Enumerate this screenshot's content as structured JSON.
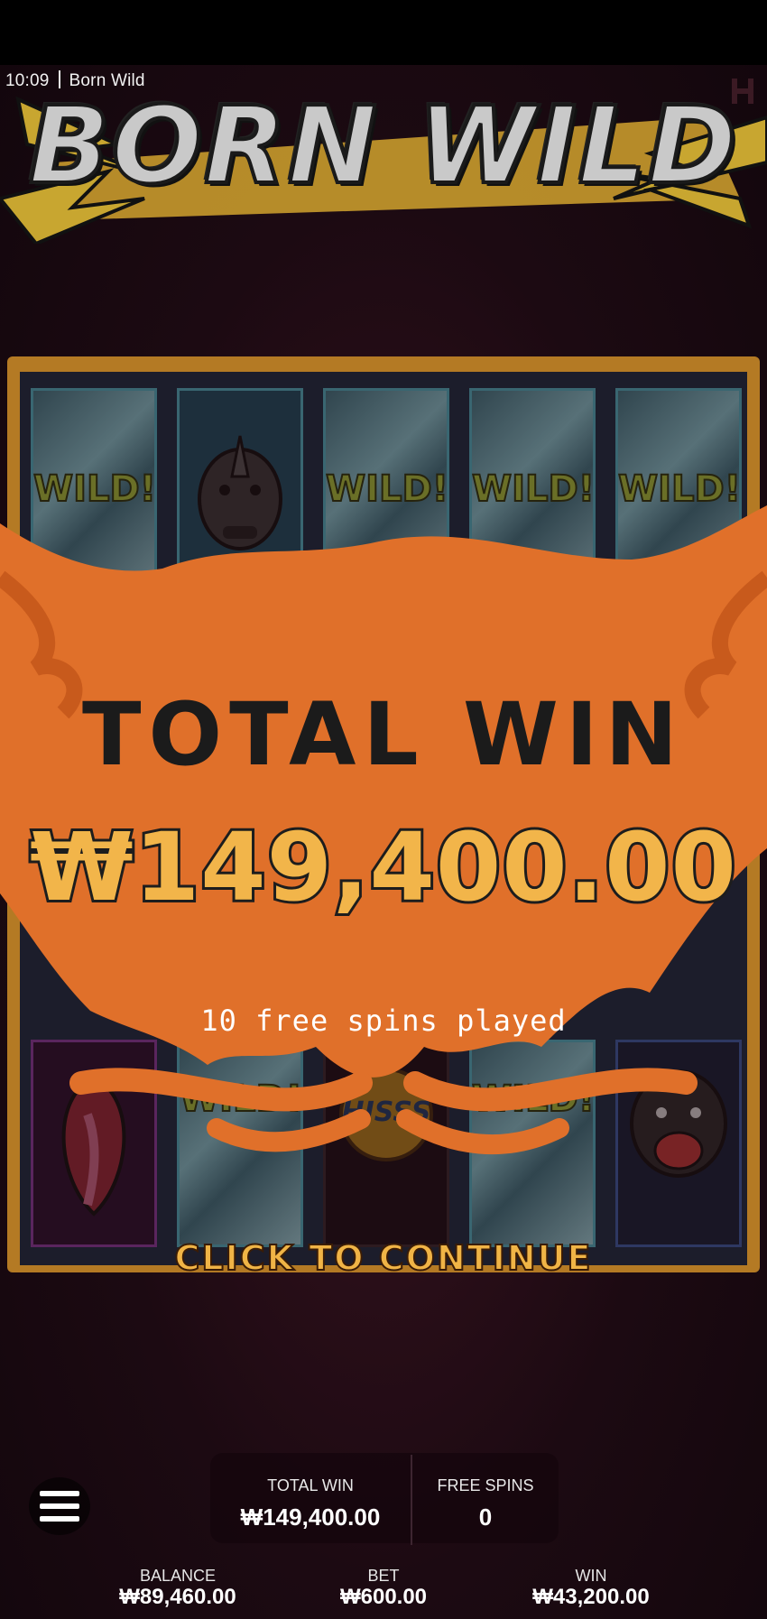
{
  "status_bar": {
    "time": "10:09",
    "app_name": "Born Wild"
  },
  "logo": {
    "text": "BORN WILD"
  },
  "reels": {
    "top_row": [
      "WILD!",
      "rhino",
      "WILD!",
      "WILD!",
      "WILD!"
    ],
    "bottom_row": [
      "cobra",
      "WILD!",
      "HISSS",
      "WILD!",
      "gorilla"
    ]
  },
  "popup": {
    "title": "TOTAL WIN",
    "amount": "₩149,400.00",
    "subtitle": "10 free spins played",
    "continue_label": "CLICK TO CONTINUE"
  },
  "panel": {
    "total_win_label": "TOTAL WIN",
    "total_win_value": "₩149,400.00",
    "free_spins_label": "FREE SPINS",
    "free_spins_value": "0"
  },
  "footer": {
    "balance_label": "BALANCE",
    "balance_value": "₩89,460.00",
    "bet_label": "BET",
    "bet_value": "₩600.00",
    "win_label": "WIN",
    "win_value": "₩43,200.00"
  },
  "colors": {
    "splash_orange": "#e0702a",
    "amount_gold": "#f2b54a",
    "wild_green": "#a8c43c",
    "frame_gold": "#b47a24",
    "background": "#1c0a12"
  }
}
